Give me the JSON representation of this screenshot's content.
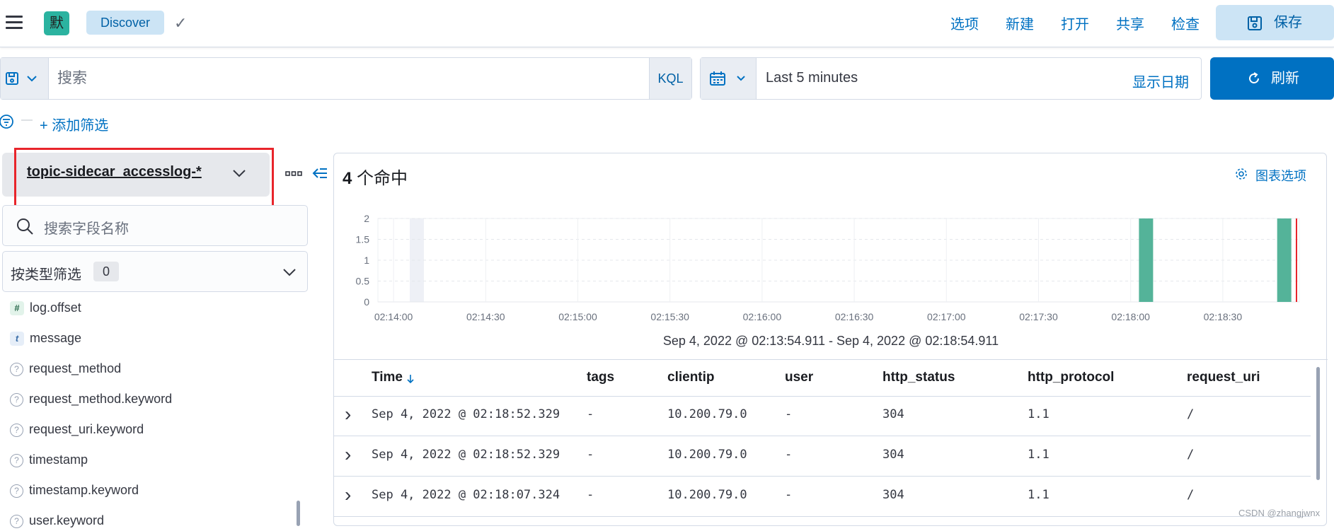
{
  "app": {
    "logo_letter": "默",
    "breadcrumb": "Discover"
  },
  "topnav": {
    "items": [
      "选项",
      "新建",
      "打开",
      "共享",
      "检查"
    ],
    "save": "保存"
  },
  "query": {
    "placeholder": "搜索",
    "language": "KQL"
  },
  "time": {
    "range": "Last 5 minutes",
    "show_dates": "显示日期",
    "refresh": "刷新"
  },
  "filters": {
    "add": "+ 添加筛选"
  },
  "sidebar": {
    "index_pattern": "topic-sidecar_accesslog-*",
    "field_search_placeholder": "搜索字段名称",
    "type_filter_label": "按类型筛选",
    "type_filter_count": "0",
    "fields": [
      {
        "type": "number",
        "type_glyph": "#",
        "name": "log.offset"
      },
      {
        "type": "string",
        "type_glyph": "t",
        "name": "message"
      },
      {
        "type": "unknown",
        "type_glyph": "?",
        "name": "request_method"
      },
      {
        "type": "unknown",
        "type_glyph": "?",
        "name": "request_method.keyword"
      },
      {
        "type": "unknown",
        "type_glyph": "?",
        "name": "request_uri.keyword"
      },
      {
        "type": "unknown",
        "type_glyph": "?",
        "name": "timestamp"
      },
      {
        "type": "unknown",
        "type_glyph": "?",
        "name": "timestamp.keyword"
      },
      {
        "type": "unknown",
        "type_glyph": "?",
        "name": "user.keyword"
      }
    ]
  },
  "results": {
    "hits_count": "4",
    "hits_label": "个命中",
    "chart_options": "图表选项",
    "time_range_label": "Sep 4, 2022 @ 02:13:54.911 - Sep 4, 2022 @ 02:18:54.911"
  },
  "chart_data": {
    "type": "bar",
    "x": [
      "02:14:00",
      "02:14:30",
      "02:15:00",
      "02:15:30",
      "02:16:00",
      "02:16:30",
      "02:17:00",
      "02:17:30",
      "02:18:00",
      "02:18:30"
    ],
    "yticks": [
      "0",
      "0.5",
      "1",
      "1.5",
      "2"
    ],
    "ylim": [
      0,
      2
    ],
    "bars": [
      {
        "x": "02:18:05",
        "value": 2
      },
      {
        "x": "02:18:50",
        "value": 2
      }
    ],
    "bar_color": "#54b399",
    "now_marker_color": "#e8252b"
  },
  "table": {
    "columns": [
      "Time",
      "tags",
      "clientip",
      "user",
      "http_status",
      "http_protocol",
      "request_uri"
    ],
    "rows": [
      [
        "Sep 4, 2022 @ 02:18:52.329",
        "-",
        "10.200.79.0",
        "-",
        "304",
        "1.1",
        "/"
      ],
      [
        "Sep 4, 2022 @ 02:18:52.329",
        "-",
        "10.200.79.0",
        "-",
        "304",
        "1.1",
        "/"
      ],
      [
        "Sep 4, 2022 @ 02:18:07.324",
        "-",
        "10.200.79.0",
        "-",
        "304",
        "1.1",
        "/"
      ]
    ]
  },
  "watermark": "CSDN @zhangjwnx"
}
